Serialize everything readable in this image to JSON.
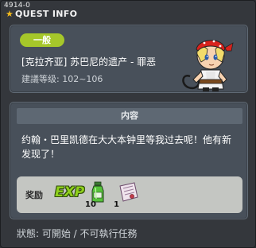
{
  "window": {
    "quest_id": "4914-0",
    "title": "QUEST INFO"
  },
  "quest": {
    "category": "一般",
    "name": "[克拉齐亚] 苏巴尼的遗产 - 罪恶",
    "level": "建議等级: 102~106"
  },
  "content": {
    "header": "内容",
    "description": "约翰・巴里凯德在大大本钟里等我过去呢！他有新发现了！"
  },
  "rewards": {
    "label": "奖励",
    "exp_label": "EXP",
    "items": [
      {
        "icon": "potion-icon",
        "quantity": "10"
      },
      {
        "icon": "scroll-icon",
        "quantity": "1"
      }
    ]
  },
  "status": {
    "text": "狀態: 可開始 / 不可執行任務"
  },
  "colors": {
    "badge": "#a6c72a",
    "exp": "#8fd01d",
    "panel": "#48505a",
    "background": "#34373c"
  }
}
